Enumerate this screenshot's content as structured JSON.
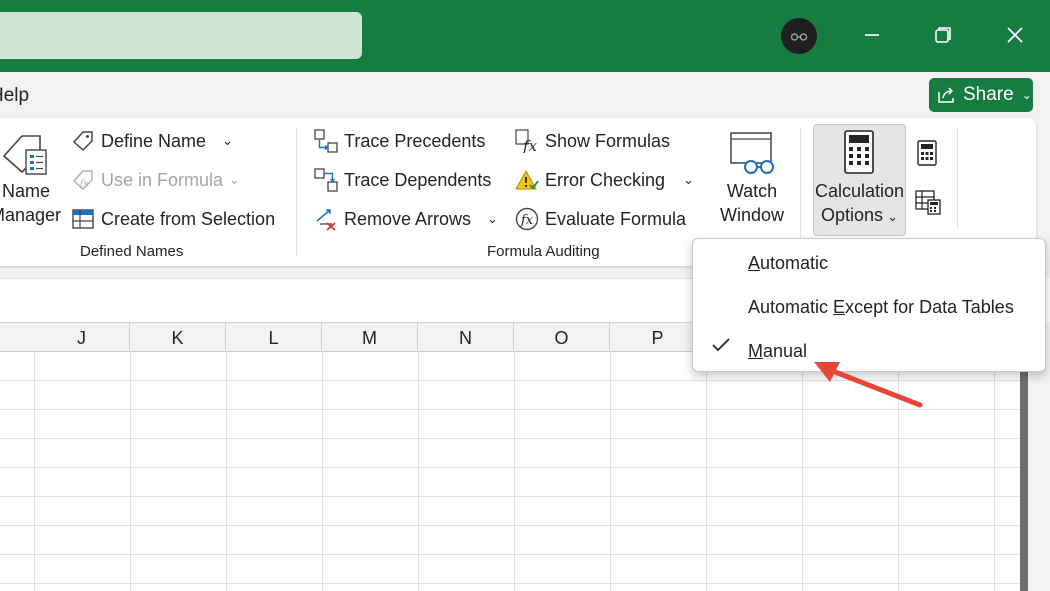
{
  "titlebar": {
    "color": "#167c42"
  },
  "menu": {
    "help_tab": "Help",
    "share_label": "Share"
  },
  "defined_names": {
    "name_manager_label_line1": "Name",
    "name_manager_label_line2": "Manager",
    "define_name": "Define Name",
    "use_in_formula": "Use in Formula",
    "create_from_selection": "Create from Selection",
    "group_label": "Defined Names"
  },
  "formula_auditing": {
    "trace_precedents": "Trace Precedents",
    "trace_dependents": "Trace Dependents",
    "remove_arrows": "Remove Arrows",
    "show_formulas": "Show Formulas",
    "error_checking": "Error Checking",
    "evaluate_formula": "Evaluate Formula",
    "watch_window_line1": "Watch",
    "watch_window_line2": "Window",
    "group_label": "Formula Auditing"
  },
  "calculation": {
    "options_line1": "Calculation",
    "options_line2": "Options"
  },
  "dropdown": {
    "options": [
      {
        "pre": "",
        "accel": "A",
        "post": "utomatic",
        "checked": false
      },
      {
        "pre": "Automatic ",
        "accel": "E",
        "post": "xcept for Data Tables",
        "checked": false
      },
      {
        "pre": "",
        "accel": "M",
        "post": "anual",
        "checked": true
      }
    ]
  },
  "grid": {
    "columns": [
      "J",
      "K",
      "L",
      "M",
      "N",
      "O",
      "P"
    ]
  },
  "annotation": {
    "arrow_color": "#e8463a"
  }
}
